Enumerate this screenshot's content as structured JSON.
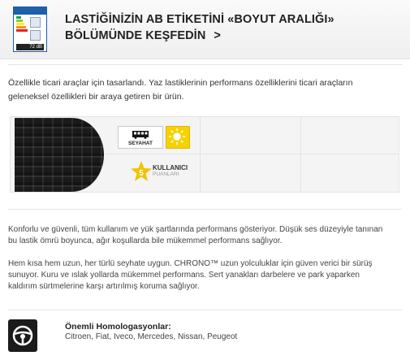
{
  "label_banner": {
    "title_line1": "LASTİĞİNİZİN AB ETİKETİNİ «BOYUT ARALIĞI»",
    "title_line2": "BÖLÜMÜNDE KEŞFEDİN",
    "arrow": ">",
    "label_icon": "eu-tyre-label-icon",
    "label_icon_text": "72 dB"
  },
  "intro": "Özellikle ticari araçlar için tasarlandı. Yaz lastiklerinin performans özelliklerini ticari araçların geleneksel özellikleri bir araya getiren bir ürün.",
  "product": {
    "usage_label": "SEYAHAT",
    "usage_icon": "bus-icon",
    "season_icon": "sun-icon",
    "rating_value": "5",
    "rating_title": "KULLANICI",
    "rating_subtitle": "PUANLARI"
  },
  "description": {
    "paragraph1": "Konforlu ve güvenli, tüm kullanım ve yük şartlarında performans gösteriyor. Düşük ses düzeyiyle tanınan bu lastik ömrü boyunca, ağır koşullarda bile mükemmel performans sağlıyor.",
    "paragraph2": "Hem kısa hem uzun, her türlü seyhate uygun. CHRONO™ uzun yolculuklar için güven verici bir sürüş sunuyor. Kuru ve ıslak yollarda mükemmel performans. Sert yanakları darbelere ve park yaparken kaldırım sürtmelerine karşı artırılmış koruma sağlıyor."
  },
  "homologations": {
    "icon": "steering-wheel-icon",
    "title": "Önemli Homologasyonlar:",
    "list": "Citroen, Fiat, Iveco, Mercedes, Nissan, Peugeot"
  },
  "colors": {
    "sun": "#f6d200",
    "label_blue": "#1d5fa8",
    "rating_star": "#f2c200"
  }
}
